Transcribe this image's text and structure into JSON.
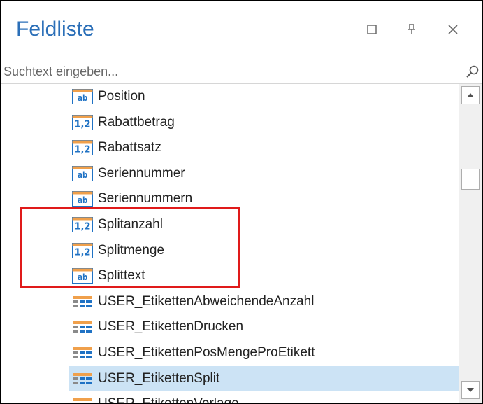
{
  "panel": {
    "title": "Feldliste",
    "window_buttons": [
      {
        "name": "maximize-icon"
      },
      {
        "name": "pin-icon"
      },
      {
        "name": "close-icon"
      }
    ]
  },
  "search": {
    "placeholder": "Suchtext eingeben...",
    "value": "",
    "icon": "search-icon"
  },
  "colors": {
    "title": "#2b6fb8",
    "selection": "#cce3f5",
    "highlight": "#e01a1a",
    "icon_orange": "#f0a04b",
    "icon_blue": "#1f72c4"
  },
  "fields": [
    {
      "label": "Position",
      "icon": "text-field-icon"
    },
    {
      "label": "Rabattbetrag",
      "icon": "numeric-field-icon"
    },
    {
      "label": "Rabattsatz",
      "icon": "numeric-field-icon"
    },
    {
      "label": "Seriennummer",
      "icon": "text-field-icon"
    },
    {
      "label": "Seriennummern",
      "icon": "text-field-icon"
    },
    {
      "label": "Splitanzahl",
      "icon": "numeric-field-icon"
    },
    {
      "label": "Splitmenge",
      "icon": "numeric-field-icon"
    },
    {
      "label": "Splittext",
      "icon": "text-field-icon"
    },
    {
      "label": "USER_EtikettenAbweichendeAnzahl",
      "icon": "table-field-icon"
    },
    {
      "label": "USER_EtikettenDrucken",
      "icon": "table-field-icon"
    },
    {
      "label": "USER_EtikettenPosMengeProEtikett",
      "icon": "table-field-icon"
    },
    {
      "label": "USER_EtikettenSplit",
      "icon": "table-field-icon",
      "selected": true
    },
    {
      "label": "USER_EtikettenVorlage",
      "icon": "table-field-icon"
    }
  ],
  "highlight": {
    "covers": [
      "Splitanzahl",
      "Splitmenge",
      "Splittext"
    ]
  }
}
